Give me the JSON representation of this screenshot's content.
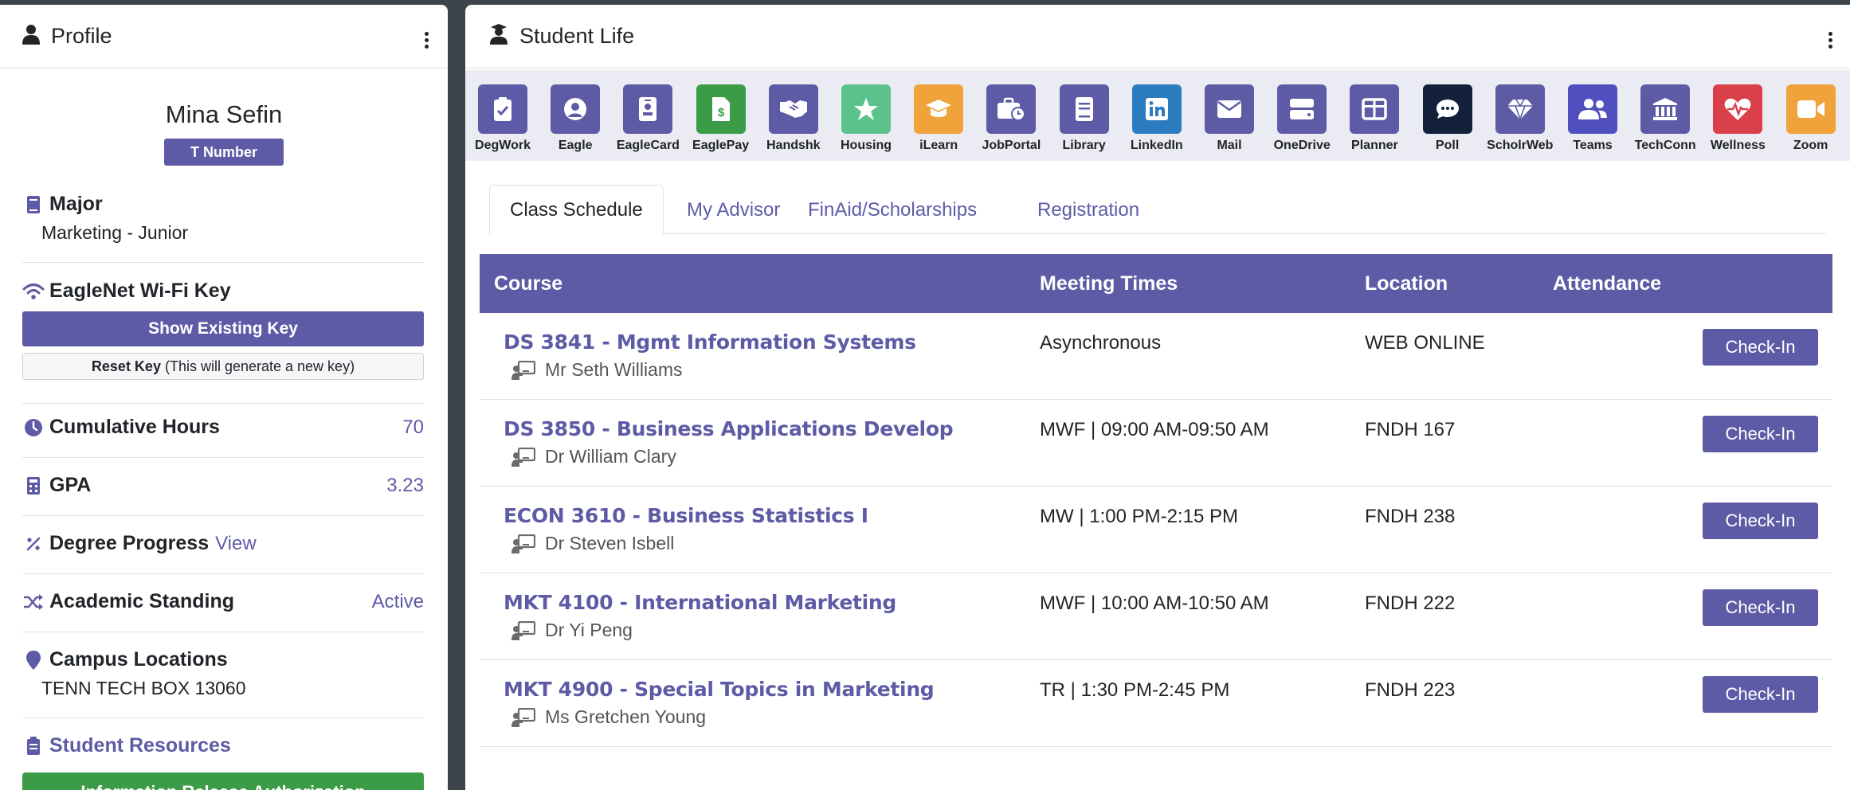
{
  "profile": {
    "header_title": "Profile",
    "name": "Mina Sefin",
    "t_number_label": "T Number",
    "major_title": "Major",
    "major_value": "Marketing - Junior",
    "wifi_title": "EagleNet Wi-Fi Key",
    "show_key_label": "Show Existing Key",
    "reset_key_bold": "Reset Key",
    "reset_key_note": "(This will generate a new key)",
    "hours_title": "Cumulative Hours",
    "hours_value": "70",
    "gpa_title": "GPA",
    "gpa_value": "3.23",
    "degree_title": "Degree Progress",
    "degree_link": "View",
    "standing_title": "Academic Standing",
    "standing_value": "Active",
    "campus_title": "Campus Locations",
    "campus_value": "TENN TECH BOX 13060",
    "resources_title": "Student Resources",
    "release_button_label": "Information Release Authorization"
  },
  "student_life": {
    "header_title": "Student Life",
    "apps": [
      {
        "label": "DegWork",
        "icon": "clipboard-check-icon",
        "color": "#5e5ba6"
      },
      {
        "label": "Eagle",
        "icon": "user-circle-icon",
        "color": "#5e5ba6"
      },
      {
        "label": "EagleCard",
        "icon": "id-badge-icon",
        "color": "#5e5ba6"
      },
      {
        "label": "EaglePay",
        "icon": "dollar-file-icon",
        "color": "#3b9b46"
      },
      {
        "label": "Handshk",
        "icon": "handshake-icon",
        "color": "#5e5ba6"
      },
      {
        "label": "Housing",
        "icon": "star-icon",
        "color": "#5cc28c"
      },
      {
        "label": "iLearn",
        "icon": "graduation-cap-icon",
        "color": "#f0a33a"
      },
      {
        "label": "JobPortal",
        "icon": "briefcase-clock-icon",
        "color": "#5e5ba6"
      },
      {
        "label": "Library",
        "icon": "book-icon",
        "color": "#5e5ba6"
      },
      {
        "label": "LinkedIn",
        "icon": "linkedin-icon",
        "color": "#2b7bbf"
      },
      {
        "label": "Mail",
        "icon": "envelope-icon",
        "color": "#5e5ba6"
      },
      {
        "label": "OneDrive",
        "icon": "hard-drive-icon",
        "color": "#5e5ba6"
      },
      {
        "label": "Planner",
        "icon": "columns-icon",
        "color": "#5e5ba6"
      },
      {
        "label": "Poll",
        "icon": "chat-bubble-icon",
        "color": "#12203a"
      },
      {
        "label": "ScholrWeb",
        "icon": "gem-icon",
        "color": "#5e5ba6"
      },
      {
        "label": "Teams",
        "icon": "users-icon",
        "color": "#4f4fc0"
      },
      {
        "label": "TechConn",
        "icon": "landmark-icon",
        "color": "#5e5ba6"
      },
      {
        "label": "Wellness",
        "icon": "heart-pulse-icon",
        "color": "#d9404a"
      },
      {
        "label": "Zoom",
        "icon": "video-camera-icon",
        "color": "#f0a33a"
      }
    ],
    "tabs": [
      "Class Schedule",
      "My Advisor",
      "FinAid/Scholarships",
      "Registration"
    ],
    "table": {
      "headers": [
        "Course",
        "Meeting Times",
        "Location",
        "Attendance"
      ],
      "rows": [
        {
          "course": "DS 3841 - Mgmt Information Systems",
          "instructor": "Mr Seth Williams",
          "times": "Asynchronous",
          "location": "WEB ONLINE",
          "action": "Check-In"
        },
        {
          "course": "DS 3850 - Business Applications Develop",
          "instructor": "Dr William Clary",
          "times": "MWF | 09:00 AM-09:50 AM",
          "location": "FNDH 167",
          "action": "Check-In"
        },
        {
          "course": "ECON 3610 - Business Statistics I",
          "instructor": "Dr Steven Isbell",
          "times": "MW | 1:00 PM-2:15 PM",
          "location": "FNDH 238",
          "action": "Check-In"
        },
        {
          "course": "MKT 4100 - International Marketing",
          "instructor": "Dr Yi Peng",
          "times": "MWF | 10:00 AM-10:50 AM",
          "location": "FNDH 222",
          "action": "Check-In"
        },
        {
          "course": "MKT 4900 - Special Topics in Marketing",
          "instructor": "Ms Gretchen Young",
          "times": "TR | 1:30 PM-2:45 PM",
          "location": "FNDH 223",
          "action": "Check-In"
        }
      ]
    }
  },
  "colors": {
    "accent": "#5e5ba6",
    "background": "#3d444c",
    "green": "#3b9b46"
  }
}
